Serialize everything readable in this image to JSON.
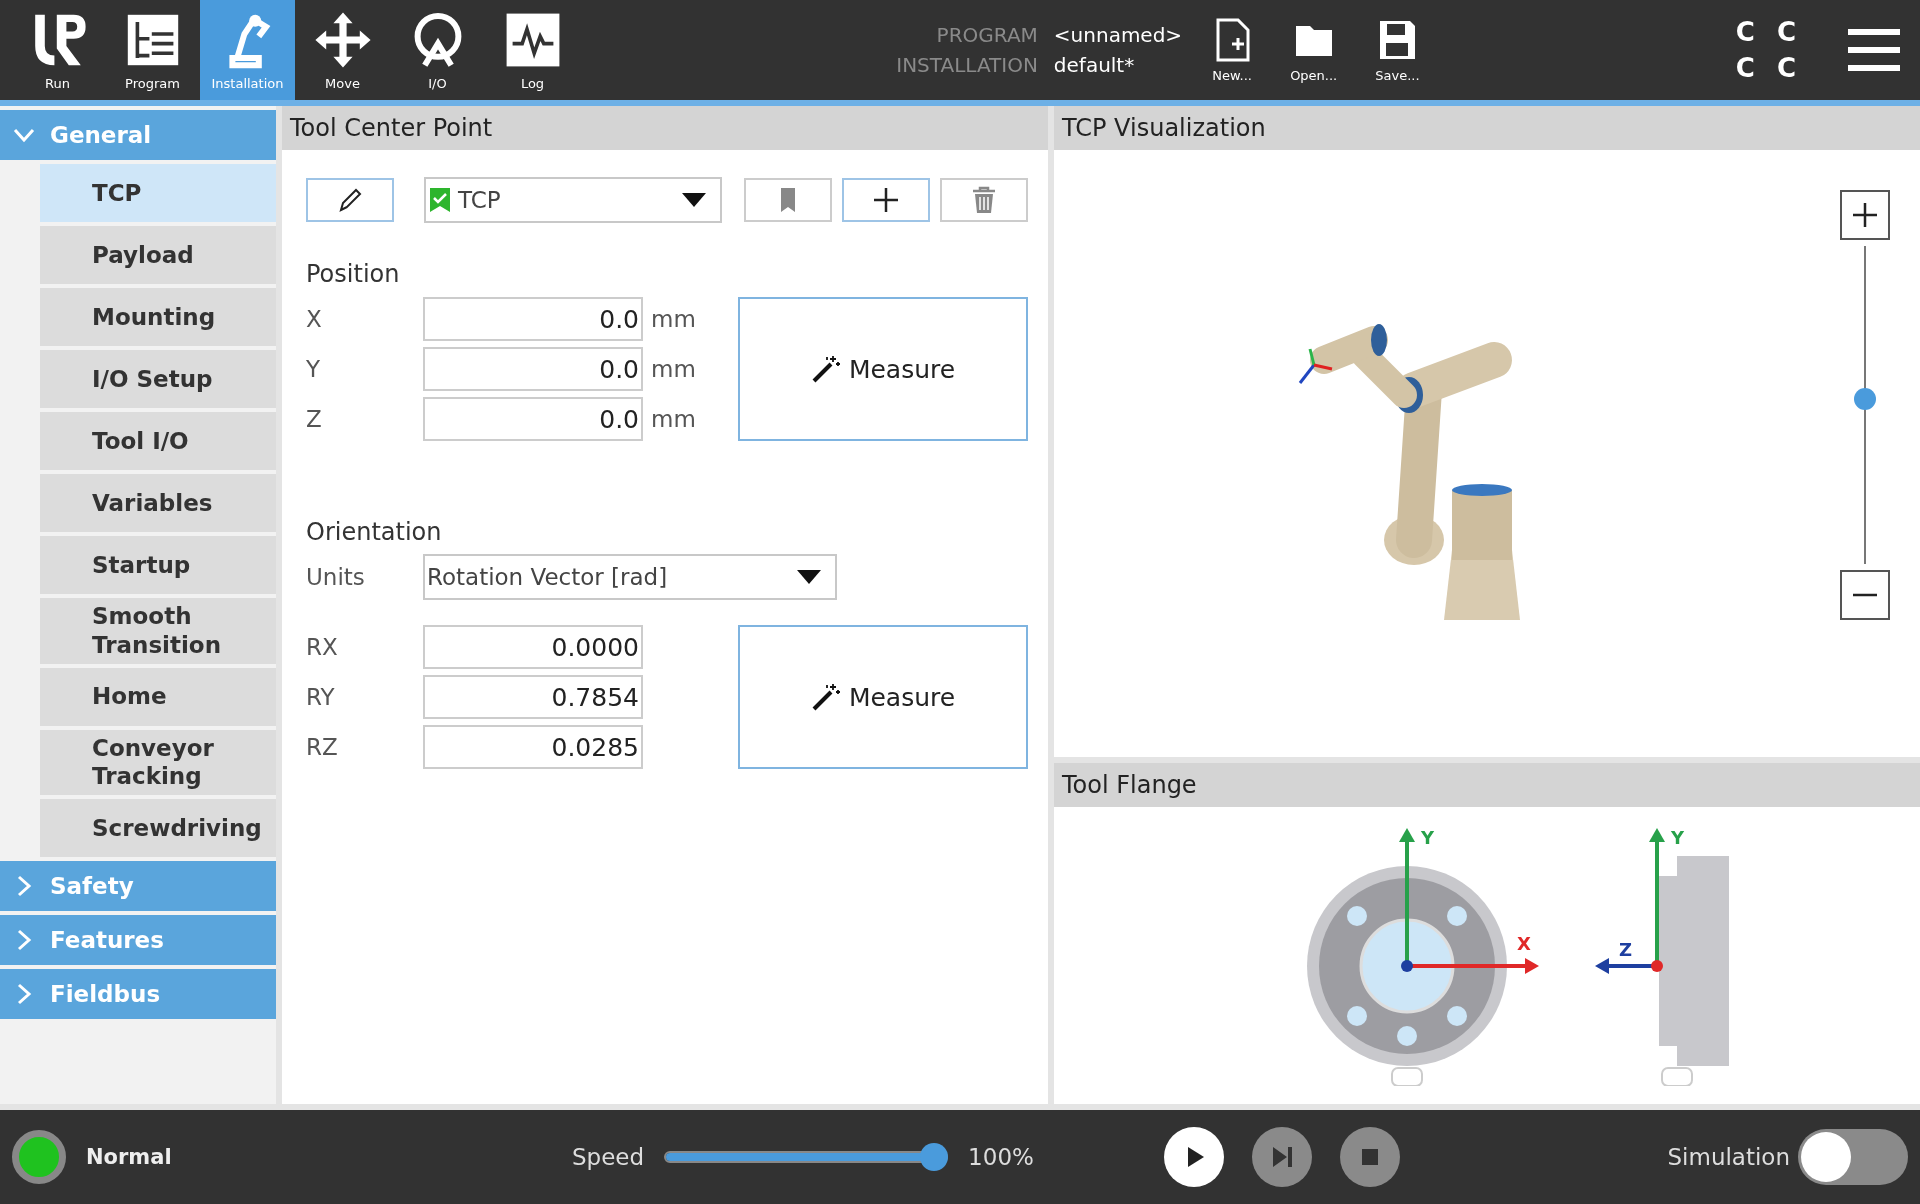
{
  "top_nav": [
    {
      "label": "Run",
      "kind": "logo",
      "selected": false
    },
    {
      "label": "Program",
      "kind": "program",
      "selected": false
    },
    {
      "label": "Installation",
      "kind": "installation",
      "selected": true
    },
    {
      "label": "Move",
      "kind": "move",
      "selected": false
    },
    {
      "label": "I/O",
      "kind": "io",
      "selected": false
    },
    {
      "label": "Log",
      "kind": "log",
      "selected": false
    }
  ],
  "program": {
    "label": "PROGRAM",
    "value": "<unnamed>"
  },
  "installation": {
    "label": "INSTALLATION",
    "value": "default*"
  },
  "file_buttons": [
    {
      "label": "New...",
      "kind": "new"
    },
    {
      "label": "Open...",
      "kind": "open"
    },
    {
      "label": "Save...",
      "kind": "save"
    }
  ],
  "status_letters": [
    "C",
    "C",
    "C",
    "C"
  ],
  "sidebar": [
    {
      "label": "General",
      "expanded": true,
      "items": [
        {
          "label": "TCP",
          "selected": true
        },
        {
          "label": "Payload",
          "selected": false
        },
        {
          "label": "Mounting",
          "selected": false
        },
        {
          "label": "I/O Setup",
          "selected": false
        },
        {
          "label": "Tool I/O",
          "selected": false
        },
        {
          "label": "Variables",
          "selected": false
        },
        {
          "label": "Startup",
          "selected": false
        },
        {
          "label": "Smooth Transition",
          "selected": false
        },
        {
          "label": "Home",
          "selected": false
        },
        {
          "label": "Conveyor Tracking",
          "selected": false
        },
        {
          "label": "Screwdriving",
          "selected": false
        }
      ]
    },
    {
      "label": "Safety",
      "expanded": false
    },
    {
      "label": "Features",
      "expanded": false
    },
    {
      "label": "Fieldbus",
      "expanded": false
    }
  ],
  "tcp_panel": {
    "title": "Tool Center Point",
    "tcp_select": {
      "value": "TCP",
      "checked": true
    },
    "position": {
      "title": "Position",
      "fields": [
        {
          "label": "X",
          "value": "0.0",
          "unit": "mm"
        },
        {
          "label": "Y",
          "value": "0.0",
          "unit": "mm"
        },
        {
          "label": "Z",
          "value": "0.0",
          "unit": "mm"
        }
      ],
      "measure": "Measure"
    },
    "orientation": {
      "title": "Orientation",
      "units_label": "Units",
      "units_value": "Rotation Vector [rad]",
      "fields": [
        {
          "label": "RX",
          "value": "0.0000"
        },
        {
          "label": "RY",
          "value": "0.7854"
        },
        {
          "label": "RZ",
          "value": "0.0285"
        }
      ],
      "measure": "Measure"
    }
  },
  "visualization": {
    "title": "TCP Visualization",
    "zoom": {
      "level": 0.52
    }
  },
  "tool_flange": {
    "title": "Tool Flange",
    "front_axes": [
      "Y",
      "X"
    ],
    "side_axes": [
      "Y",
      "Z"
    ]
  },
  "status_bar": {
    "state": "Normal",
    "speed_label": "Speed",
    "speed": {
      "level": 1.0
    },
    "speed_reading": "100%",
    "simulation_label": "Simulation",
    "simulation_on": false
  }
}
